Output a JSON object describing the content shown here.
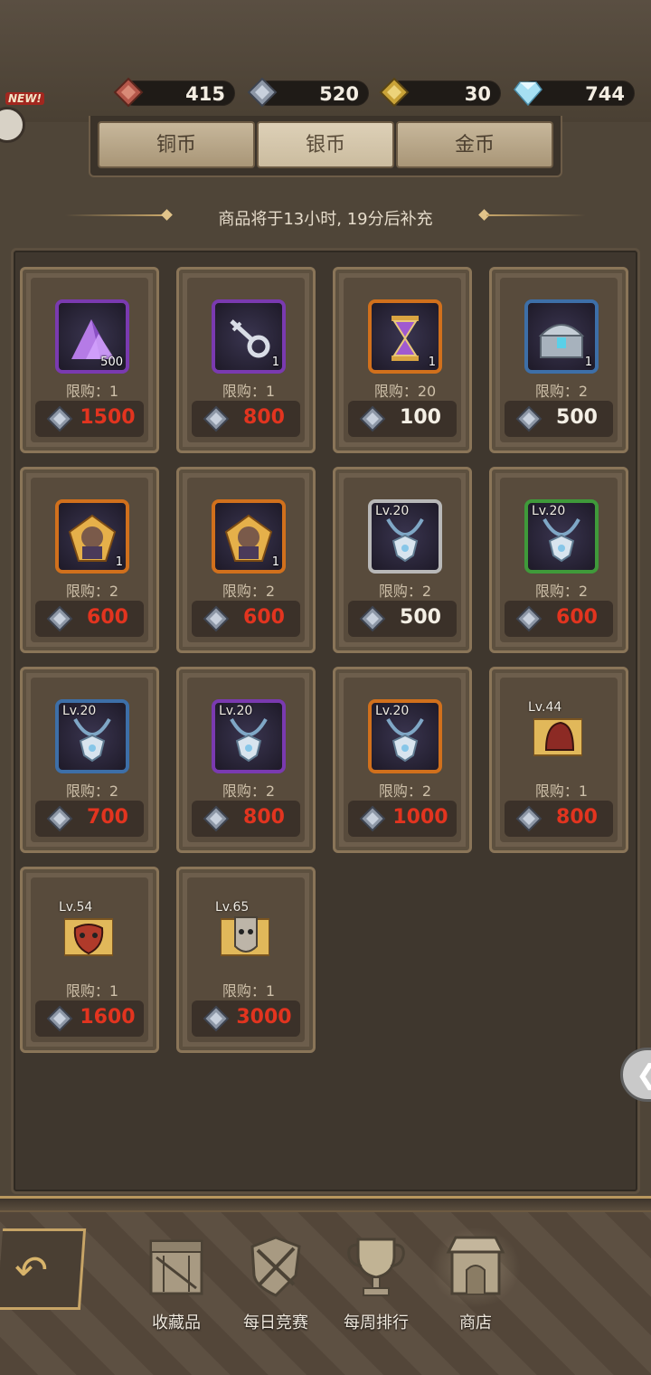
{
  "currencies": [
    {
      "name": "copper",
      "value": "415",
      "color": "#b4574a"
    },
    {
      "name": "silver",
      "value": "520",
      "color": "#8d97a6"
    },
    {
      "name": "gold",
      "value": "30",
      "color": "#c9a338"
    },
    {
      "name": "diamond",
      "value": "744",
      "color": "#a6dff2"
    }
  ],
  "new_badge": "NEW!",
  "tabs": [
    {
      "label": "铜币",
      "active": false
    },
    {
      "label": "银币",
      "active": true
    },
    {
      "label": "金币",
      "active": false
    }
  ],
  "restock_text": "商品将于13小时, 19分后补充",
  "items": [
    {
      "icon": "purple-crystal-icon",
      "rarity_color": "#7a3ab0",
      "qty": "500",
      "lv": "",
      "limit": "限购：1",
      "price": "1500",
      "price_red": true
    },
    {
      "icon": "key-icon",
      "rarity_color": "#7a3ab0",
      "qty": "1",
      "lv": "",
      "limit": "限购：1",
      "price": "800",
      "price_red": true
    },
    {
      "icon": "hourglass-icon",
      "rarity_color": "#d1701c",
      "qty": "1",
      "lv": "",
      "limit": "限购：20",
      "price": "100",
      "price_red": false
    },
    {
      "icon": "chest-icon",
      "rarity_color": "#3d6fa8",
      "qty": "1",
      "lv": "",
      "limit": "限购：2",
      "price": "500",
      "price_red": false
    },
    {
      "icon": "hero-portrait-icon",
      "rarity_color": "#d1701c",
      "qty": "1",
      "lv": "",
      "limit": "限购：2",
      "price": "600",
      "price_red": true
    },
    {
      "icon": "hero-portrait-icon",
      "rarity_color": "#d1701c",
      "qty": "1",
      "lv": "",
      "limit": "限购：2",
      "price": "600",
      "price_red": true
    },
    {
      "icon": "necklace-icon",
      "rarity_color": "#b8b8b8",
      "qty": "",
      "lv": "Lv.20",
      "limit": "限购：2",
      "price": "500",
      "price_red": false
    },
    {
      "icon": "necklace-icon",
      "rarity_color": "#3f9a3a",
      "qty": "",
      "lv": "Lv.20",
      "limit": "限购：2",
      "price": "600",
      "price_red": true
    },
    {
      "icon": "necklace-icon",
      "rarity_color": "#3d6fa8",
      "qty": "",
      "lv": "Lv.20",
      "limit": "限购：2",
      "price": "700",
      "price_red": true
    },
    {
      "icon": "necklace-icon",
      "rarity_color": "#7a3ab0",
      "qty": "",
      "lv": "Lv.20",
      "limit": "限购：2",
      "price": "800",
      "price_red": true
    },
    {
      "icon": "necklace-icon",
      "rarity_color": "#d1701c",
      "qty": "",
      "lv": "Lv.20",
      "limit": "限购：2",
      "price": "1000",
      "price_red": true
    },
    {
      "icon": "helmet-scroll-icon",
      "rarity_color": "",
      "qty": "",
      "lv": "Lv.44",
      "limit": "限购：1",
      "price": "800",
      "price_red": true
    },
    {
      "icon": "mask-scroll-icon",
      "rarity_color": "",
      "qty": "",
      "lv": "Lv.54",
      "limit": "限购：1",
      "price": "1600",
      "price_red": true
    },
    {
      "icon": "shield-scroll-icon",
      "rarity_color": "",
      "qty": "",
      "lv": "Lv.65",
      "limit": "限购：1",
      "price": "3000",
      "price_red": true
    }
  ],
  "nav": [
    {
      "label": "收藏品",
      "icon": "crate-icon"
    },
    {
      "label": "每日竞赛",
      "icon": "shovel-shield-icon"
    },
    {
      "label": "每周排行",
      "icon": "trophy-icon"
    },
    {
      "label": "商店",
      "icon": "shop-icon",
      "active": true
    }
  ]
}
